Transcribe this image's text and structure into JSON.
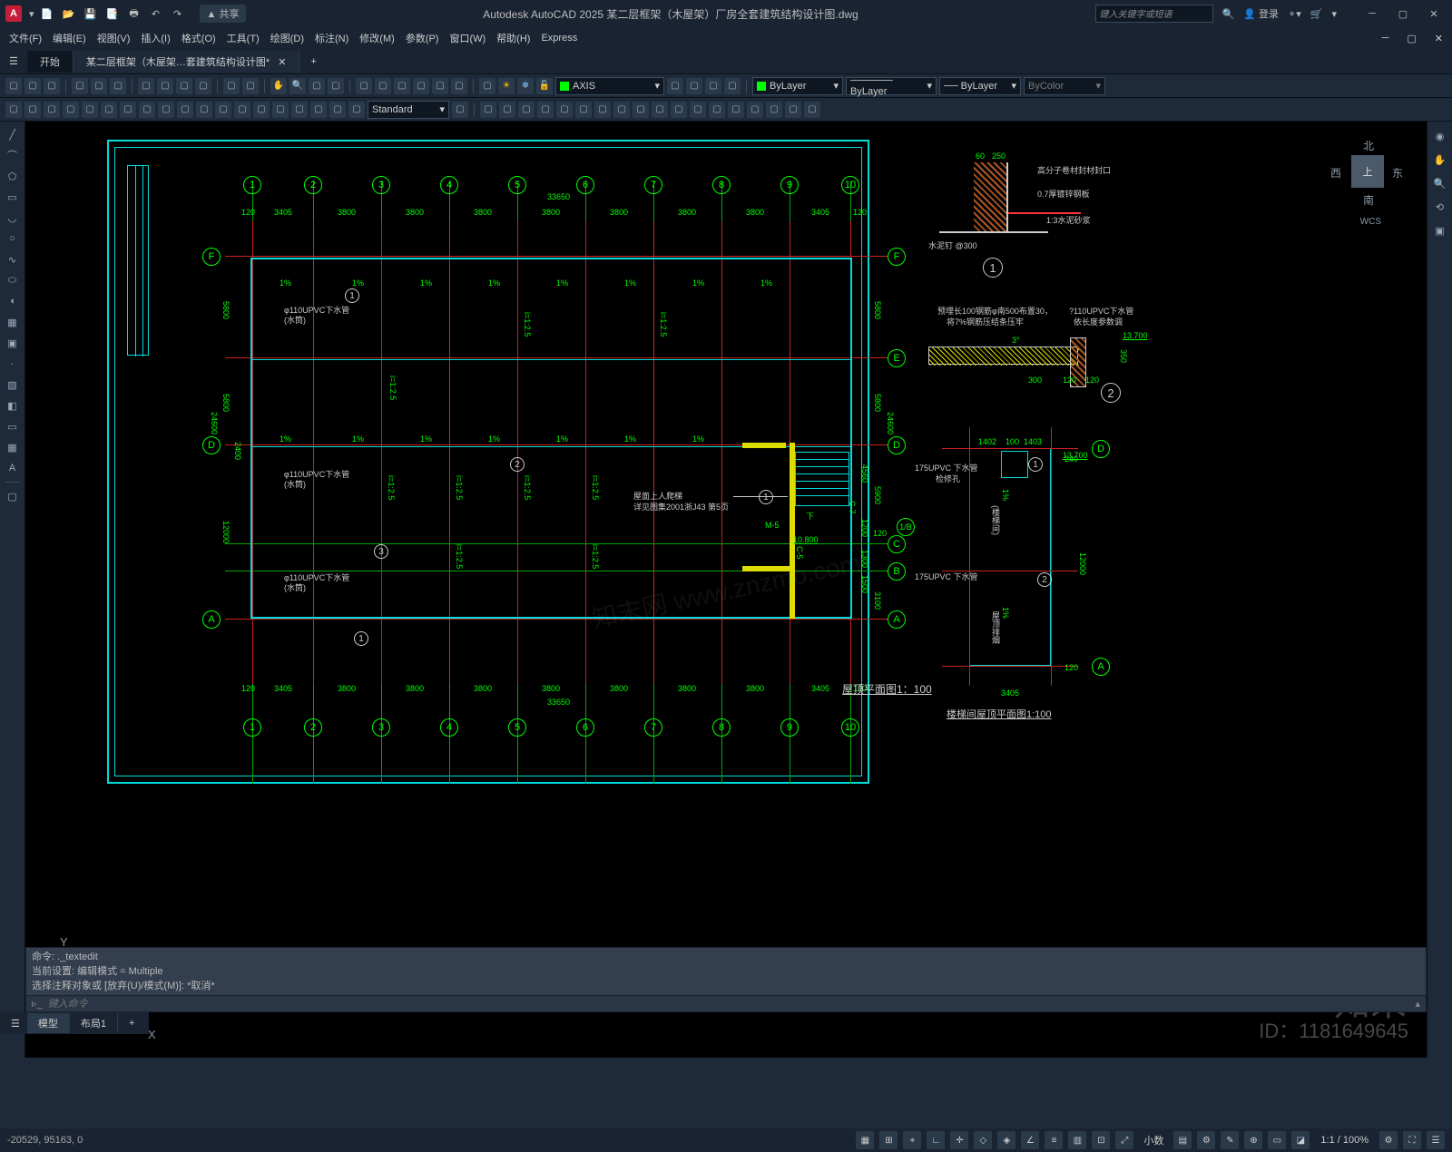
{
  "title_bar": {
    "app_title": "Autodesk AutoCAD 2025   某二层框架（木屋架）厂房全套建筑结构设计图.dwg",
    "share": "共享",
    "search_placeholder": "键入关键字或短语",
    "login": "登录"
  },
  "menu": {
    "file": "文件(F)",
    "edit": "编辑(E)",
    "view": "视图(V)",
    "insert": "插入(I)",
    "format": "格式(O)",
    "tools": "工具(T)",
    "draw": "绘图(D)",
    "dimension": "标注(N)",
    "modify": "修改(M)",
    "params": "参数(P)",
    "window": "窗口(W)",
    "help": "帮助(H)",
    "express": "Express"
  },
  "tabs": {
    "start": "开始",
    "file": "某二层框架（木屋架…套建筑结构设计图*",
    "add": "+"
  },
  "toolbar": {
    "layer_axis": "AXIS",
    "bylayer": "ByLayer",
    "bycolor": "ByColor",
    "standard": "Standard"
  },
  "viewcube": {
    "top": "上",
    "n": "北",
    "s": "南",
    "e": "东",
    "w": "西",
    "wcs": "WCS"
  },
  "ucs": {
    "x": "X",
    "y": "Y"
  },
  "drawing": {
    "total_width": "33650",
    "spans_top": [
      "120",
      "3405",
      "3800",
      "3800",
      "3800",
      "3800",
      "3800",
      "3800",
      "3800",
      "3405",
      "120"
    ],
    "left_spans": [
      "5800",
      "5800",
      "24600",
      "12000"
    ],
    "left_spans2": [
      "2400"
    ],
    "right_spans": [
      "5800",
      "5800",
      "24600",
      "3100",
      "4560",
      "5900",
      "1200",
      "120",
      "1300",
      "1500"
    ],
    "stair_dims": [
      "10.800",
      "M-5",
      "C-5",
      "C-7"
    ],
    "grid_nums": [
      "1",
      "2",
      "3",
      "4",
      "5",
      "6",
      "7",
      "8",
      "9",
      "10"
    ],
    "grid_letters": [
      "A",
      "B",
      "C",
      "D",
      "E",
      "F"
    ],
    "grid_letters_r": [
      "1/B"
    ],
    "slope_txt": "1%",
    "slope_v": "i=1:2.5",
    "pipe_label": "φ110UPVC下水管",
    "pipe_sub": "(水筒)",
    "stair_note1": "屋面上人爬梯",
    "stair_note2": "详见图集2001浙J43 第5页",
    "stair_label_down": "下",
    "plan_title": "屋顶平面图1：100",
    "detail1": {
      "a": "60",
      "b": "250",
      "n1": "高分子卷材封材封口",
      "n2": "0.7厚镀锌钢板",
      "n3": "1:3水泥砂浆",
      "n4": "水泥钉 @300",
      "label": "1"
    },
    "detail2": {
      "n1": "预埋长100钢筋φ南500布置30，",
      "n2": "将7%钢筋压结条压牢",
      "n3": "?110UPVC下水管",
      "n4": "依长度参数调",
      "d1": "300",
      "d2": "120",
      "d3": "120",
      "slope": "3°",
      "h": "350",
      "elev": "13.700",
      "label": "2"
    },
    "stair_plan": {
      "title": "楼梯间屋顶平面图1:100",
      "pipe": "175UPVC 下水管",
      "dims": [
        "1402",
        "100",
        "1403",
        "240",
        "120",
        "12000",
        "3405"
      ],
      "elev": "13.700",
      "slope": "1%",
      "note1": "(楼梯间)",
      "note2": "检修孔",
      "note3": "屋顶排烟"
    },
    "inner_bubbles": [
      "1",
      "2",
      "3"
    ]
  },
  "cmd": {
    "l1": "命令: ._textedit",
    "l2": "当前设置: 编辑模式 = Multiple",
    "l3": "选择注释对象或 [放弃(U)/模式(M)]: *取消*",
    "placeholder": "键入命令"
  },
  "bottom_tabs": {
    "model": "模型",
    "layout1": "布局1",
    "add": "+"
  },
  "status": {
    "coords": "-20529, 95163, 0",
    "xiaoshu": "小数",
    "zoom": "1:1 / 100%"
  },
  "watermark": {
    "brand": "知末",
    "id": "ID：1181649645"
  }
}
